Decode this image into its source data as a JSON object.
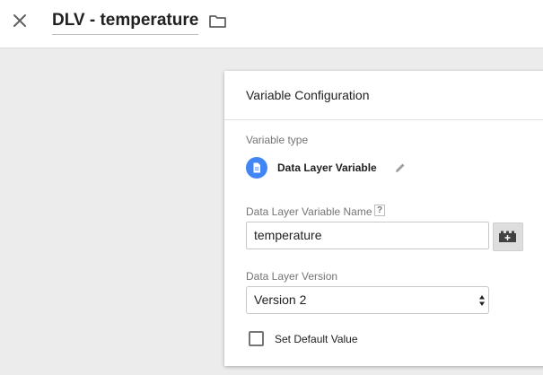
{
  "header": {
    "title": "DLV - temperature",
    "close_icon": "close-icon",
    "folder_icon": "folder-icon"
  },
  "card": {
    "title": "Variable Configuration",
    "variable_type_label": "Variable type",
    "variable_type_name": "Data Layer Variable",
    "variable_type_icon": "document-icon",
    "variable_name_label": "Data Layer Variable Name",
    "help_badge": "?",
    "variable_name_value": "temperature",
    "version_label": "Data Layer Version",
    "version_selected": "Version 2",
    "default_value_label": "Set Default Value",
    "default_value_checked": false
  },
  "colors": {
    "accent": "#4285f4",
    "background": "#ececec",
    "card": "#ffffff"
  }
}
